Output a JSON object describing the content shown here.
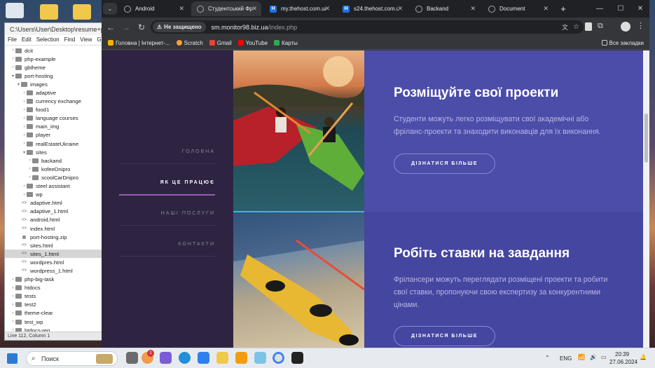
{
  "editor": {
    "title": "C:\\Users\\User\\Desktop\\resume+port",
    "menu": [
      "File",
      "Edit",
      "Selection",
      "Find",
      "View",
      "Go"
    ],
    "tree": [
      {
        "label": "dcit",
        "depth": 2,
        "kind": "folder",
        "open": false
      },
      {
        "label": "php-example",
        "depth": 2,
        "kind": "folder",
        "open": false
      },
      {
        "label": "gbtheme",
        "depth": 2,
        "kind": "folder",
        "open": false
      },
      {
        "label": "port-hosting",
        "depth": 2,
        "kind": "folder",
        "open": true
      },
      {
        "label": "images",
        "depth": 3,
        "kind": "folder",
        "open": true
      },
      {
        "label": "adaptive",
        "depth": 4,
        "kind": "folder",
        "open": false
      },
      {
        "label": "currency exchange",
        "depth": 4,
        "kind": "folder",
        "open": false
      },
      {
        "label": "food1",
        "depth": 4,
        "kind": "folder",
        "open": false
      },
      {
        "label": "language courses",
        "depth": 4,
        "kind": "folder",
        "open": false
      },
      {
        "label": "main_img",
        "depth": 4,
        "kind": "folder",
        "open": false
      },
      {
        "label": "player",
        "depth": 4,
        "kind": "folder",
        "open": false
      },
      {
        "label": "realEstateUkraine",
        "depth": 4,
        "kind": "folder",
        "open": false
      },
      {
        "label": "sites",
        "depth": 4,
        "kind": "folder",
        "open": true
      },
      {
        "label": "backand",
        "depth": 5,
        "kind": "folder",
        "open": false
      },
      {
        "label": "kofeeDnipro",
        "depth": 5,
        "kind": "folder",
        "open": false
      },
      {
        "label": "scoolCarDnipro",
        "depth": 5,
        "kind": "folder",
        "open": false
      },
      {
        "label": "steel assistant",
        "depth": 4,
        "kind": "folder",
        "open": false
      },
      {
        "label": "wp",
        "depth": 4,
        "kind": "folder",
        "open": false
      },
      {
        "label": "adaptive.html",
        "depth": 3,
        "kind": "html"
      },
      {
        "label": "adaptive_1.html",
        "depth": 3,
        "kind": "html"
      },
      {
        "label": "android.html",
        "depth": 3,
        "kind": "html"
      },
      {
        "label": "index.html",
        "depth": 3,
        "kind": "html"
      },
      {
        "label": "port-hosting.zip",
        "depth": 3,
        "kind": "zip"
      },
      {
        "label": "sites.html",
        "depth": 3,
        "kind": "html"
      },
      {
        "label": "sites_1.html",
        "depth": 3,
        "kind": "html",
        "selected": true
      },
      {
        "label": "wordpres.html",
        "depth": 3,
        "kind": "html"
      },
      {
        "label": "wordpress_1.html",
        "depth": 3,
        "kind": "html"
      },
      {
        "label": "php-big-task",
        "depth": 2,
        "kind": "folder",
        "open": false
      },
      {
        "label": "htdocs",
        "depth": 2,
        "kind": "folder",
        "open": false
      },
      {
        "label": "tests",
        "depth": 2,
        "kind": "folder",
        "open": false
      },
      {
        "label": "test2",
        "depth": 2,
        "kind": "folder",
        "open": false
      },
      {
        "label": "theme-clear",
        "depth": 2,
        "kind": "folder",
        "open": false
      },
      {
        "label": "test_wp",
        "depth": 2,
        "kind": "folder",
        "open": false
      },
      {
        "label": "htdocs-reg",
        "depth": 2,
        "kind": "folder",
        "open": false
      }
    ],
    "status": "Line 112, Column 1"
  },
  "browser": {
    "tabs": [
      {
        "label": "Android",
        "icon": "globe"
      },
      {
        "label": "Студентський Фрі",
        "icon": "globe",
        "active": true
      },
      {
        "label": "my.thehost.com.ua",
        "icon": "h"
      },
      {
        "label": "s24.thehost.com.ua",
        "icon": "h"
      },
      {
        "label": "Backand",
        "icon": "globe"
      },
      {
        "label": "Document",
        "icon": "globe"
      }
    ],
    "new_tab": "+",
    "security_chip": "Не защищено",
    "url_host": "sm.monitor98.biz.ua",
    "url_path": "/index.php",
    "bookmarks": [
      {
        "label": "Головна | Інтернет-...",
        "color": "#f4b400"
      },
      {
        "label": "Scratch",
        "color": "#f8a03c"
      },
      {
        "label": "Gmail",
        "color": "#ea4335"
      },
      {
        "label": "YouTube",
        "color": "#ff0000"
      },
      {
        "label": "Карты",
        "color": "#34a853"
      }
    ],
    "all_bookmarks": "Все закладки"
  },
  "site": {
    "nav": [
      "ГОЛОВНА",
      "ЯК ЦЕ ПРАЦЮЄ",
      "НАШІ ПОСЛУГИ",
      "КОНТАКТИ"
    ],
    "active_nav": 1,
    "sections": [
      {
        "title": "Розміщуйте свої проекти",
        "text": "Студенти можуть легко розміщувати свої академічні або фріланс-проекти та знаходити виконавців для їх виконання.",
        "button": "ДІЗНАТИСЯ БІЛЬШЕ"
      },
      {
        "title": "Робіть ставки на завдання",
        "text": "Фрілансери можуть переглядати розміщені проекти та робити свої ставки, пропонуючи свою експертизу за конкурентними цінами.",
        "button": "ДІЗНАТИСЯ БІЛЬШЕ"
      }
    ]
  },
  "taskbar": {
    "search": "Поиск",
    "lang": "ENG",
    "time": "20:39",
    "date": "27.06.2024",
    "badge": "1"
  }
}
